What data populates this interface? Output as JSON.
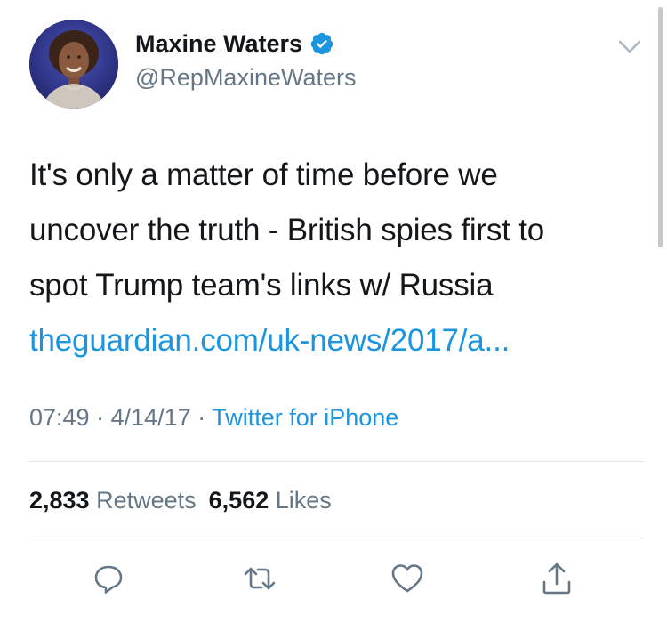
{
  "author": {
    "display_name": "Maxine Waters",
    "handle": "@RepMaxineWaters",
    "verified": true
  },
  "tweet": {
    "lines": [
      "It's only a matter of time before we",
      "uncover the truth - British spies first to",
      "spot Trump team's links w/ Russia"
    ],
    "link_text": "theguardian.com/uk-news/2017/a...",
    "time": "07:49",
    "date": "4/14/17",
    "separator": "·",
    "source": "Twitter for iPhone"
  },
  "stats": {
    "retweets_count": "2,833",
    "retweets_label": "Retweets",
    "likes_count": "6,562",
    "likes_label": "Likes"
  },
  "icons": {
    "verified": "verified-badge-icon",
    "caret": "chevron-down-icon",
    "reply": "reply-icon",
    "retweet": "retweet-icon",
    "like": "heart-icon",
    "share": "share-icon"
  },
  "colors": {
    "text": "#14171a",
    "secondary": "#657786",
    "link": "#1b95e0",
    "divider": "#e1e8ed"
  }
}
